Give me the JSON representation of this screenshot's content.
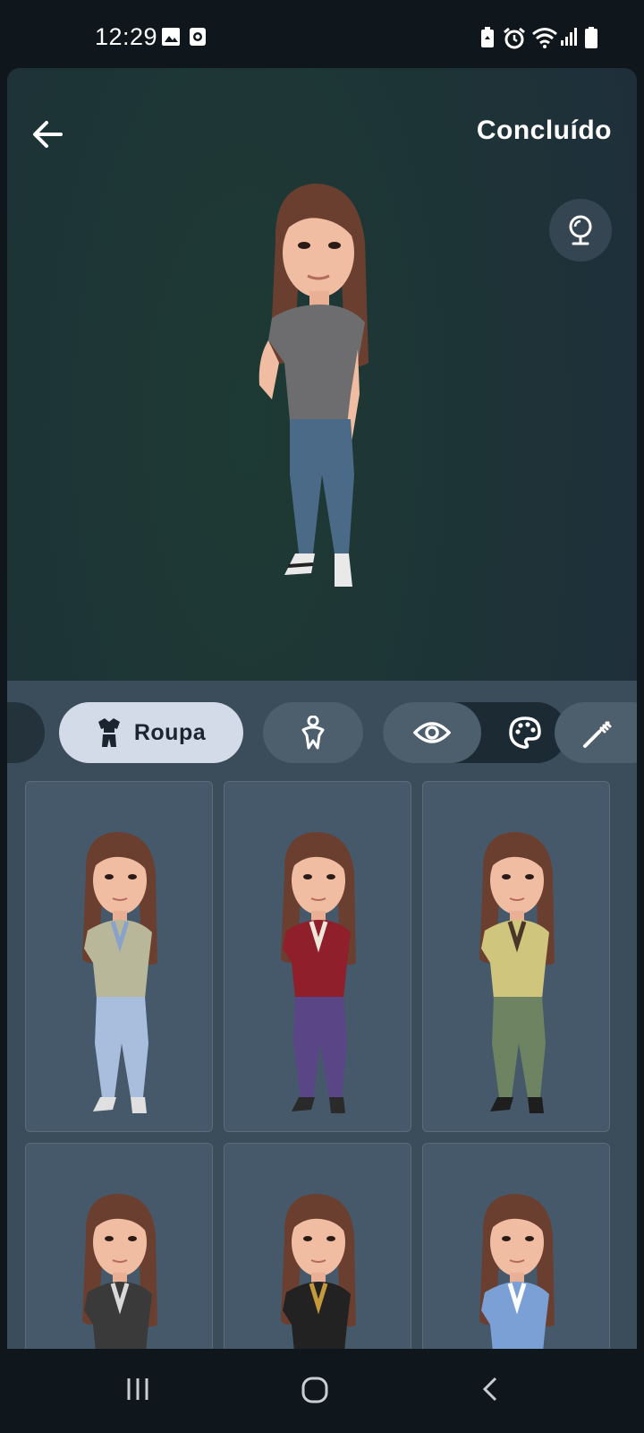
{
  "status_bar": {
    "time": "12:29",
    "left_icons": [
      "image-icon",
      "record-icon"
    ],
    "right_icons": [
      "battery-saver-icon",
      "alarm-icon",
      "wifi-icon",
      "signal-icon",
      "battery-icon"
    ]
  },
  "header": {
    "back_icon": "arrow-left-icon",
    "done_label": "Concluído",
    "mirror_icon": "mirror-icon"
  },
  "tabs": [
    {
      "id": "previous",
      "icon": "partial-tab"
    },
    {
      "id": "roupa",
      "label": "Roupa",
      "icon": "outfit-icon",
      "selected": true
    },
    {
      "id": "body",
      "icon": "body-icon"
    },
    {
      "id": "eye",
      "icon": "eye-icon"
    },
    {
      "id": "palette",
      "icon": "palette-icon"
    },
    {
      "id": "brush",
      "icon": "brush-icon"
    }
  ],
  "outfits": [
    {
      "top": "#b8b79a",
      "bottom": "#a9bedc",
      "shoes": "#e0e0e0",
      "accent": "#8aa2c8"
    },
    {
      "top": "#8e1f2b",
      "bottom": "#5a4686",
      "shoes": "#2a2a2a",
      "accent": "#efe6da"
    },
    {
      "top": "#cfc57d",
      "bottom": "#6e8361",
      "shoes": "#1e1e1e",
      "accent": "#4a3528"
    },
    {
      "top": "#3a3a3a",
      "bottom": "#3a3a3a",
      "shoes": "#3a3a3a",
      "accent": "#d9d9d9"
    },
    {
      "top": "#222222",
      "bottom": "#222222",
      "shoes": "#222222",
      "accent": "#c59a3b"
    },
    {
      "top": "#7aa0d6",
      "bottom": "#7aa0d6",
      "shoes": "#ffffff",
      "accent": "#ffffff"
    }
  ],
  "navbar": {
    "icons": [
      "recents-icon",
      "home-icon",
      "back-nav-icon"
    ]
  }
}
